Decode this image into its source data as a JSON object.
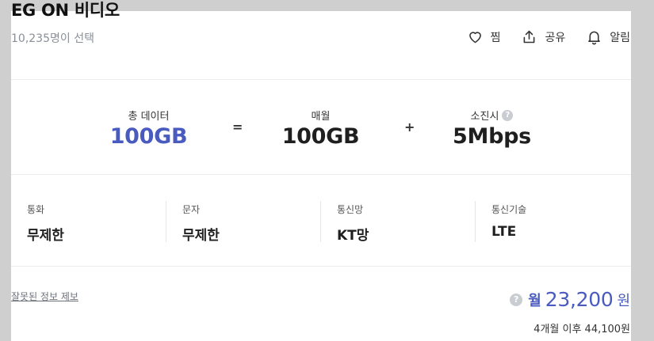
{
  "header": {
    "title": "EG ON 비디오",
    "subtitle": "10,235명이 선택",
    "actions": [
      {
        "label": "찜",
        "icon": "heart-icon"
      },
      {
        "label": "공유",
        "icon": "share-icon"
      },
      {
        "label": "알림",
        "icon": "bell-icon"
      }
    ]
  },
  "data_summary": {
    "total": {
      "label": "총 데이터",
      "value": "100GB",
      "color": "#4a5bbf"
    },
    "equals": "=",
    "monthly": {
      "label": "매월",
      "value": "100GB"
    },
    "plus": "+",
    "exhausted": {
      "label": "소진시",
      "value": "5Mbps",
      "help_icon": "question-icon",
      "help_text": "?"
    }
  },
  "specs": [
    {
      "label": "통화",
      "value": "무제한"
    },
    {
      "label": "문자",
      "value": "무제한"
    },
    {
      "label": "통신망",
      "value": "KT망"
    },
    {
      "label": "통신기술",
      "value": "LTE"
    }
  ],
  "footer": {
    "report_link": "잘못된 정보 제보",
    "price_help": "?",
    "price_prefix": "월",
    "price": "23,200",
    "price_unit": "원",
    "after_price": "4개월 이후 44,100원",
    "accent_color": "#4a5bbf"
  }
}
